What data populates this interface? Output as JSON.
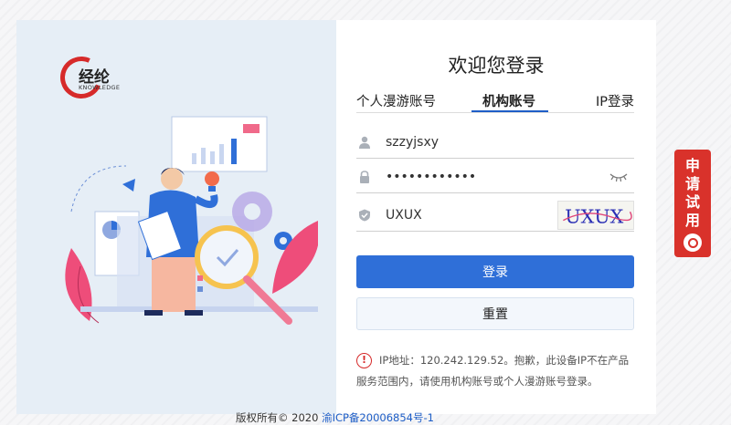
{
  "logo": {
    "name": "经纶",
    "sub": "KNOWLEDGE"
  },
  "login": {
    "title": "欢迎您登录",
    "tabs": [
      "个人漫游账号",
      "机构账号",
      "IP登录"
    ],
    "active_tab": "机构账号",
    "username": "szzyjsxy",
    "password": "••••••••••••",
    "captcha_input": "UXUX",
    "captcha_image_text": "UXUX",
    "login_button": "登录",
    "reset_button": "重置",
    "notice": "IP地址：120.242.129.52。抱歉，此设备IP不在产品服务范围内，请使用机构账号或个人漫游账号登录。"
  },
  "footer": {
    "copyright": "版权所有© 2020",
    "icp": "渝ICP备20006854号-1"
  },
  "trial": {
    "chars": [
      "申",
      "请",
      "试",
      "用"
    ]
  },
  "colors": {
    "primary": "#2f6fd8",
    "brand_red": "#d62a2a",
    "illustration_bg": "#e6eef6"
  }
}
